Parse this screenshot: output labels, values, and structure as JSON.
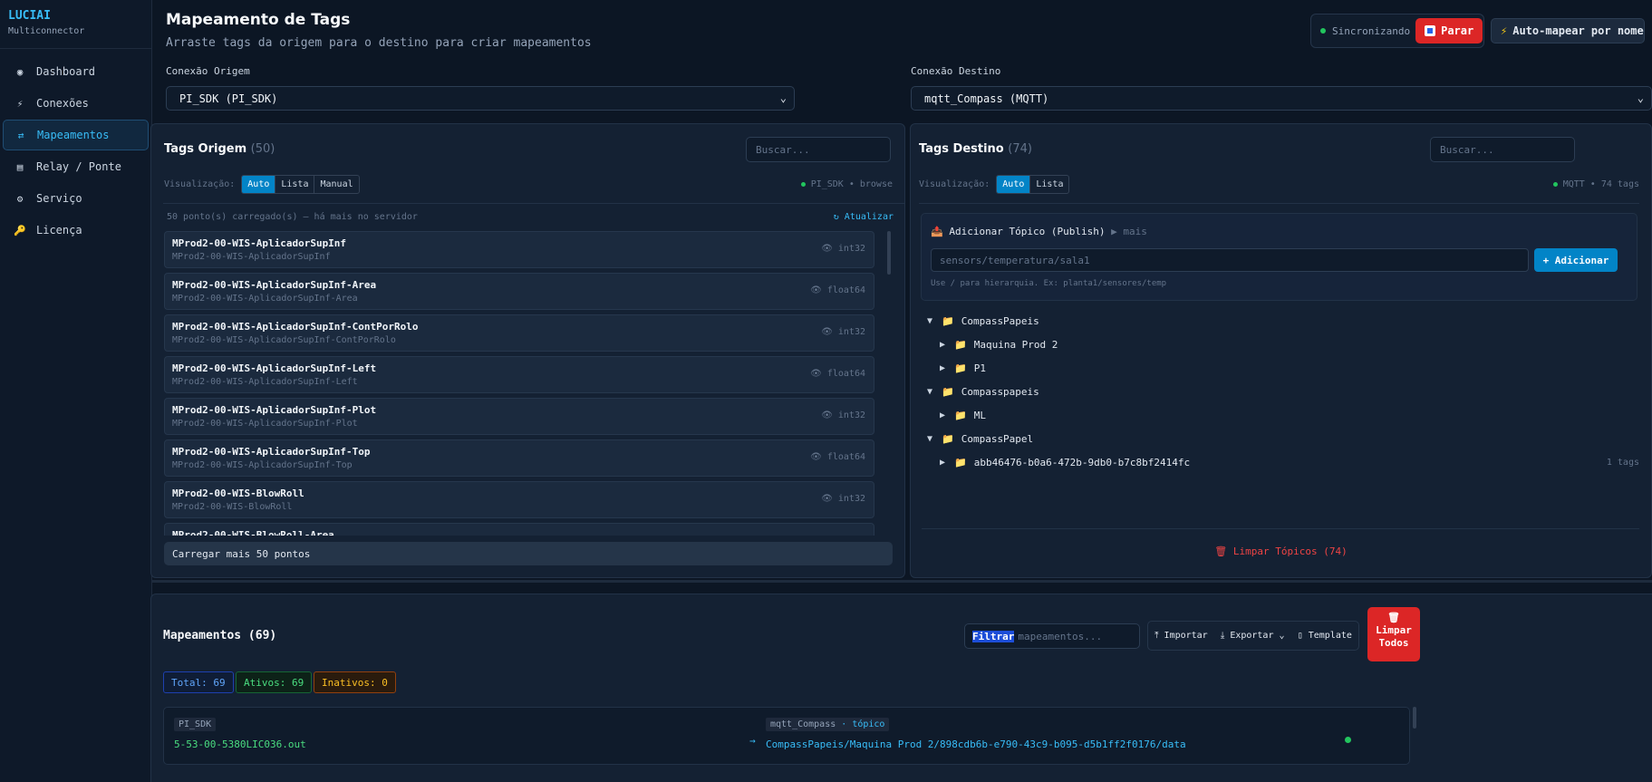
{
  "brand": {
    "title": "LUCIAI",
    "subtitle": "Multiconnector"
  },
  "sidebar": {
    "items": [
      {
        "label": "Dashboard",
        "icon": "dashboard-icon",
        "glyph": "◉"
      },
      {
        "label": "Conexões",
        "icon": "lightning-icon",
        "glyph": "⚡"
      },
      {
        "label": "Mapeamentos",
        "icon": "swap-icon",
        "glyph": "⇄",
        "active": true
      },
      {
        "label": "Relay / Ponte",
        "icon": "bridge-icon",
        "glyph": "▤"
      },
      {
        "label": "Serviço",
        "icon": "gear-icon",
        "glyph": "⚙"
      },
      {
        "label": "Licença",
        "icon": "key-icon",
        "glyph": "🔑"
      }
    ]
  },
  "header": {
    "title": "Mapeamento de Tags",
    "subtitle": "Arraste tags da origem para o destino para criar mapeamentos",
    "sync_status": "Sincronizando",
    "stop_label": "Parar",
    "auto_map_label": "Auto-mapear por nome"
  },
  "connections": {
    "source_label": "Conexão Origem",
    "source_value": "PI_SDK (PI_SDK)",
    "target_label": "Conexão Destino",
    "target_value": "mqtt_Compass (MQTT)"
  },
  "source_panel": {
    "title": "Tags Origem",
    "count": "(50)",
    "search_placeholder": "Buscar...",
    "view_label": "Visualização:",
    "view_modes": [
      "Auto",
      "Lista",
      "Manual"
    ],
    "status": "PI_SDK • browse",
    "loaded_info": "50 ponto(s) carregado(s) — há mais no servidor",
    "refresh_label": "↻ Atualizar",
    "tags": [
      {
        "name": "MProd2-00-WIS-AplicadorSupInf",
        "path": "MProd2-00-WIS-AplicadorSupInf",
        "type": "int32"
      },
      {
        "name": "MProd2-00-WIS-AplicadorSupInf-Area",
        "path": "MProd2-00-WIS-AplicadorSupInf-Area",
        "type": "float64"
      },
      {
        "name": "MProd2-00-WIS-AplicadorSupInf-ContPorRolo",
        "path": "MProd2-00-WIS-AplicadorSupInf-ContPorRolo",
        "type": "int32"
      },
      {
        "name": "MProd2-00-WIS-AplicadorSupInf-Left",
        "path": "MProd2-00-WIS-AplicadorSupInf-Left",
        "type": "float64"
      },
      {
        "name": "MProd2-00-WIS-AplicadorSupInf-Plot",
        "path": "MProd2-00-WIS-AplicadorSupInf-Plot",
        "type": "int32"
      },
      {
        "name": "MProd2-00-WIS-AplicadorSupInf-Top",
        "path": "MProd2-00-WIS-AplicadorSupInf-Top",
        "type": "float64"
      },
      {
        "name": "MProd2-00-WIS-BlowRoll",
        "path": "MProd2-00-WIS-BlowRoll",
        "type": "int32"
      },
      {
        "name": "MProd2-00-WIS-BlowRoll-Area",
        "path": "",
        "type": ""
      }
    ],
    "load_more_label": "Carregar mais 50 pontos"
  },
  "target_panel": {
    "title": "Tags Destino",
    "count": "(74)",
    "search_placeholder": "Buscar...",
    "view_label": "Visualização:",
    "view_modes": [
      "Auto",
      "Lista"
    ],
    "status": "MQTT • 74 tags",
    "publish_title": "Adicionar Tópico (Publish)",
    "publish_more": "▶ mais",
    "publish_placeholder": "sensors/temperatura/sala1",
    "add_label": "+ Adicionar",
    "publish_hint": "Use / para hierarquia. Ex: planta1/sensores/temp",
    "tree": [
      {
        "label": "CompassPapeis",
        "level": 0,
        "expanded": true,
        "count": ""
      },
      {
        "label": "Maquina Prod 2",
        "level": 1,
        "expanded": false,
        "count": ""
      },
      {
        "label": "P1",
        "level": 1,
        "expanded": false,
        "count": ""
      },
      {
        "label": "Compasspapeis",
        "level": 0,
        "expanded": true,
        "count": ""
      },
      {
        "label": "ML",
        "level": 1,
        "expanded": false,
        "count": ""
      },
      {
        "label": "CompassPapel",
        "level": 0,
        "expanded": true,
        "count": ""
      },
      {
        "label": "abb46476-b0a6-472b-9db0-b7c8bf2414fc",
        "level": 1,
        "expanded": false,
        "count": "1 tags"
      }
    ],
    "clear_label": "Limpar Tópicos (74)"
  },
  "mappings": {
    "title": "Mapeamentos (69)",
    "filter_highlight": "Filtrar",
    "filter_placeholder": "mapeamentos...",
    "import_label": "Importar",
    "export_label": "Exportar",
    "template_label": "Template",
    "clear_all_line1": "Limpar",
    "clear_all_line2": "Todos",
    "total": "Total: 69",
    "active": "Ativos: 69",
    "inactive": "Inativos: 0",
    "rows": [
      {
        "source_conn": "PI_SDK",
        "source_tag": "5-53-00-5380LIC036.out",
        "target_conn": "mqtt_Compass",
        "target_kind": "tópico",
        "target_tag": "CompassPapeis/Maquina Prod 2/898cdb6b-e790-43c9-b095-d5b1ff2f0176/data"
      }
    ]
  },
  "colors": {
    "accent": "#38bdf8",
    "danger": "#dc2626",
    "success": "#22c55e",
    "bg": "#0c1624"
  }
}
